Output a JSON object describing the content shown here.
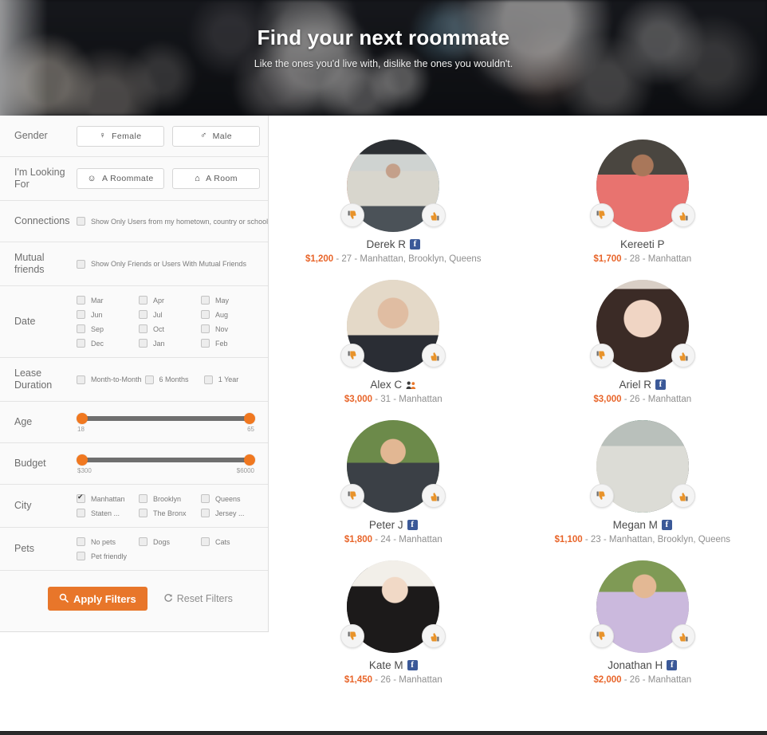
{
  "hero": {
    "title": "Find your next roommate",
    "subtitle": "Like the ones you'd live with, dislike the ones you wouldn't."
  },
  "filters": {
    "gender": {
      "label": "Gender",
      "options": [
        {
          "label": "Female",
          "icon": "female-icon",
          "glyph": "♀",
          "selected": false
        },
        {
          "label": "Male",
          "icon": "male-icon",
          "glyph": "♂",
          "selected": false
        }
      ]
    },
    "looking_for": {
      "label": "I'm Looking For",
      "options": [
        {
          "label": "A Roommate",
          "icon": "smiley-icon",
          "glyph": "☺",
          "selected": false
        },
        {
          "label": "A Room",
          "icon": "home-icon",
          "glyph": "⌂",
          "selected": false
        }
      ]
    },
    "connections": {
      "label": "Connections",
      "checkbox": {
        "label": "Show Only Users from my hometown, country or school",
        "checked": false
      }
    },
    "mutual_friends": {
      "label": "Mutual friends",
      "checkbox": {
        "label": "Show Only Friends or Users With Mutual Friends",
        "checked": false
      }
    },
    "date": {
      "label": "Date",
      "options": [
        {
          "label": "Mar",
          "checked": false
        },
        {
          "label": "Apr",
          "checked": false
        },
        {
          "label": "May",
          "checked": false
        },
        {
          "label": "Jun",
          "checked": false
        },
        {
          "label": "Jul",
          "checked": false
        },
        {
          "label": "Aug",
          "checked": false
        },
        {
          "label": "Sep",
          "checked": false
        },
        {
          "label": "Oct",
          "checked": false
        },
        {
          "label": "Nov",
          "checked": false
        },
        {
          "label": "Dec",
          "checked": false
        },
        {
          "label": "Jan",
          "checked": false
        },
        {
          "label": "Feb",
          "checked": false
        }
      ]
    },
    "lease_duration": {
      "label": "Lease Duration",
      "options": [
        {
          "label": "Month-to-Month",
          "checked": false
        },
        {
          "label": "6 Months",
          "checked": false
        },
        {
          "label": "1 Year",
          "checked": false
        }
      ]
    },
    "age": {
      "label": "Age",
      "min_label": "18",
      "max_label": "65",
      "min": 18,
      "max": 65
    },
    "budget": {
      "label": "Budget",
      "min_label": "$300",
      "max_label": "$6000",
      "min": 300,
      "max": 6000
    },
    "city": {
      "label": "City",
      "options": [
        {
          "label": "Manhattan",
          "checked": true
        },
        {
          "label": "Brooklyn",
          "checked": false
        },
        {
          "label": "Queens",
          "checked": false
        },
        {
          "label": "Staten ...",
          "checked": false
        },
        {
          "label": "The Bronx",
          "checked": false
        },
        {
          "label": "Jersey ...",
          "checked": false
        }
      ]
    },
    "pets": {
      "label": "Pets",
      "options": [
        {
          "label": "No pets",
          "checked": false
        },
        {
          "label": "Dogs",
          "checked": false
        },
        {
          "label": "Cats",
          "checked": false
        },
        {
          "label": "Pet friendly",
          "checked": false
        }
      ]
    },
    "apply_button": {
      "label": "Apply Filters",
      "icon": "search-icon",
      "glyph": "🔍"
    },
    "reset_button": {
      "label": "Reset Filters",
      "icon": "refresh-icon",
      "glyph": "↻"
    }
  },
  "colors": {
    "accent_orange": "#e8762a",
    "price_orange": "#e8652a",
    "slider_handle": "#f07820",
    "slider_track": "#6f6f6f",
    "facebook_blue": "#3b5998",
    "vote_icon": "#e8932a"
  },
  "vote_buttons": {
    "dislike": {
      "name": "thumbs-down-icon",
      "glyph": "👎"
    },
    "like": {
      "name": "thumbs-up-icon",
      "glyph": "👍"
    }
  },
  "results": [
    {
      "name": "Derek R",
      "badge": "facebook",
      "price": "$1,200",
      "meta": " - 27 - Manhattan, Brooklyn, Queens",
      "age": 27,
      "cities": "Manhattan, Brooklyn, Queens",
      "photo_desc": "man-in-sunglasses-on-subway"
    },
    {
      "name": "Kereeti P",
      "badge": "none",
      "price": "$1,700",
      "meta": " - 28 - Manhattan",
      "age": 28,
      "cities": "Manhattan",
      "photo_desc": "man-in-pink-shirt-at-bar"
    },
    {
      "name": "Alex C",
      "badge": "mutual-friends",
      "price": "$3,000",
      "meta": " - 31 - Manhattan",
      "age": 31,
      "cities": "Manhattan",
      "photo_desc": "man-in-suit-and-tie"
    },
    {
      "name": "Ariel R",
      "badge": "facebook",
      "price": "$3,000",
      "meta": " - 26 - Manhattan",
      "age": 26,
      "cities": "Manhattan",
      "photo_desc": "young-woman-dark-hair-selfie"
    },
    {
      "name": "Peter J",
      "badge": "facebook",
      "price": "$1,800",
      "meta": " - 24 - Manhattan",
      "age": 24,
      "cities": "Manhattan",
      "photo_desc": "smiling-man-outdoors-checked-shirt"
    },
    {
      "name": "Megan M",
      "badge": "facebook",
      "price": "$1,100",
      "meta": " - 23 - Manhattan, Brooklyn, Queens",
      "age": 23,
      "cities": "Manhattan, Brooklyn, Queens",
      "photo_desc": "graduation-photo-with-family"
    },
    {
      "name": "Kate M",
      "badge": "facebook",
      "price": "$1,450",
      "meta": " - 26 - Manhattan",
      "age": 26,
      "cities": "Manhattan",
      "photo_desc": "blonde-woman-in-black-lace-top"
    },
    {
      "name": "Jonathan H",
      "badge": "facebook",
      "price": "$2,000",
      "meta": " - 26 - Manhattan",
      "age": 26,
      "cities": "Manhattan",
      "photo_desc": "man-in-lavender-shirt-outdoors"
    }
  ]
}
